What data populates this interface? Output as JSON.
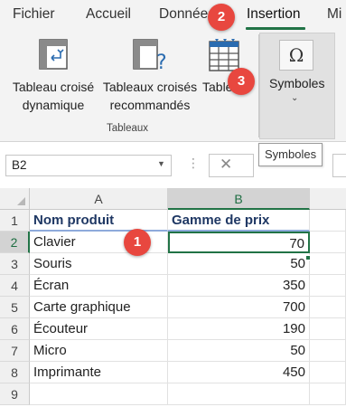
{
  "ribbon": {
    "tabs": [
      {
        "label": "Fichier"
      },
      {
        "label": "Accueil"
      },
      {
        "label": "Données"
      },
      {
        "label": "Insertion"
      },
      {
        "label": "Mi"
      }
    ],
    "active_tab": "Insertion",
    "buttons": {
      "pivot_line1": "Tableau croisé",
      "pivot_line2": "dynamique",
      "recommended_line1": "Tableaux croisés",
      "recommended_line2": "recommandés",
      "table_label": "Tableau",
      "symbols_label": "Symboles",
      "symbols_caret": "⌄",
      "omega": "Ω"
    },
    "group_label": "Tableaux",
    "tooltip": "Symboles"
  },
  "callouts": [
    "1",
    "2",
    "3"
  ],
  "formula_bar": {
    "name_box": "B2",
    "cancel": "✕",
    "dots": "⋮"
  },
  "grid": {
    "columns": [
      "A",
      "B"
    ],
    "rows": [
      "1",
      "2",
      "3",
      "4",
      "5",
      "6",
      "7",
      "8",
      "9"
    ],
    "header": {
      "a": "Nom produit",
      "b": "Gamme de prix"
    },
    "data": [
      {
        "a": "Clavier",
        "b": "70"
      },
      {
        "a": "Souris",
        "b": "50"
      },
      {
        "a": "Écran",
        "b": "350"
      },
      {
        "a": "Carte graphique",
        "b": "700"
      },
      {
        "a": "Écouteur",
        "b": "190"
      },
      {
        "a": "Micro",
        "b": "50"
      },
      {
        "a": "Imprimante",
        "b": "450"
      }
    ]
  },
  "colors": {
    "accent": "#217346",
    "callout": "#e8473f",
    "header_text": "#1f3864"
  }
}
